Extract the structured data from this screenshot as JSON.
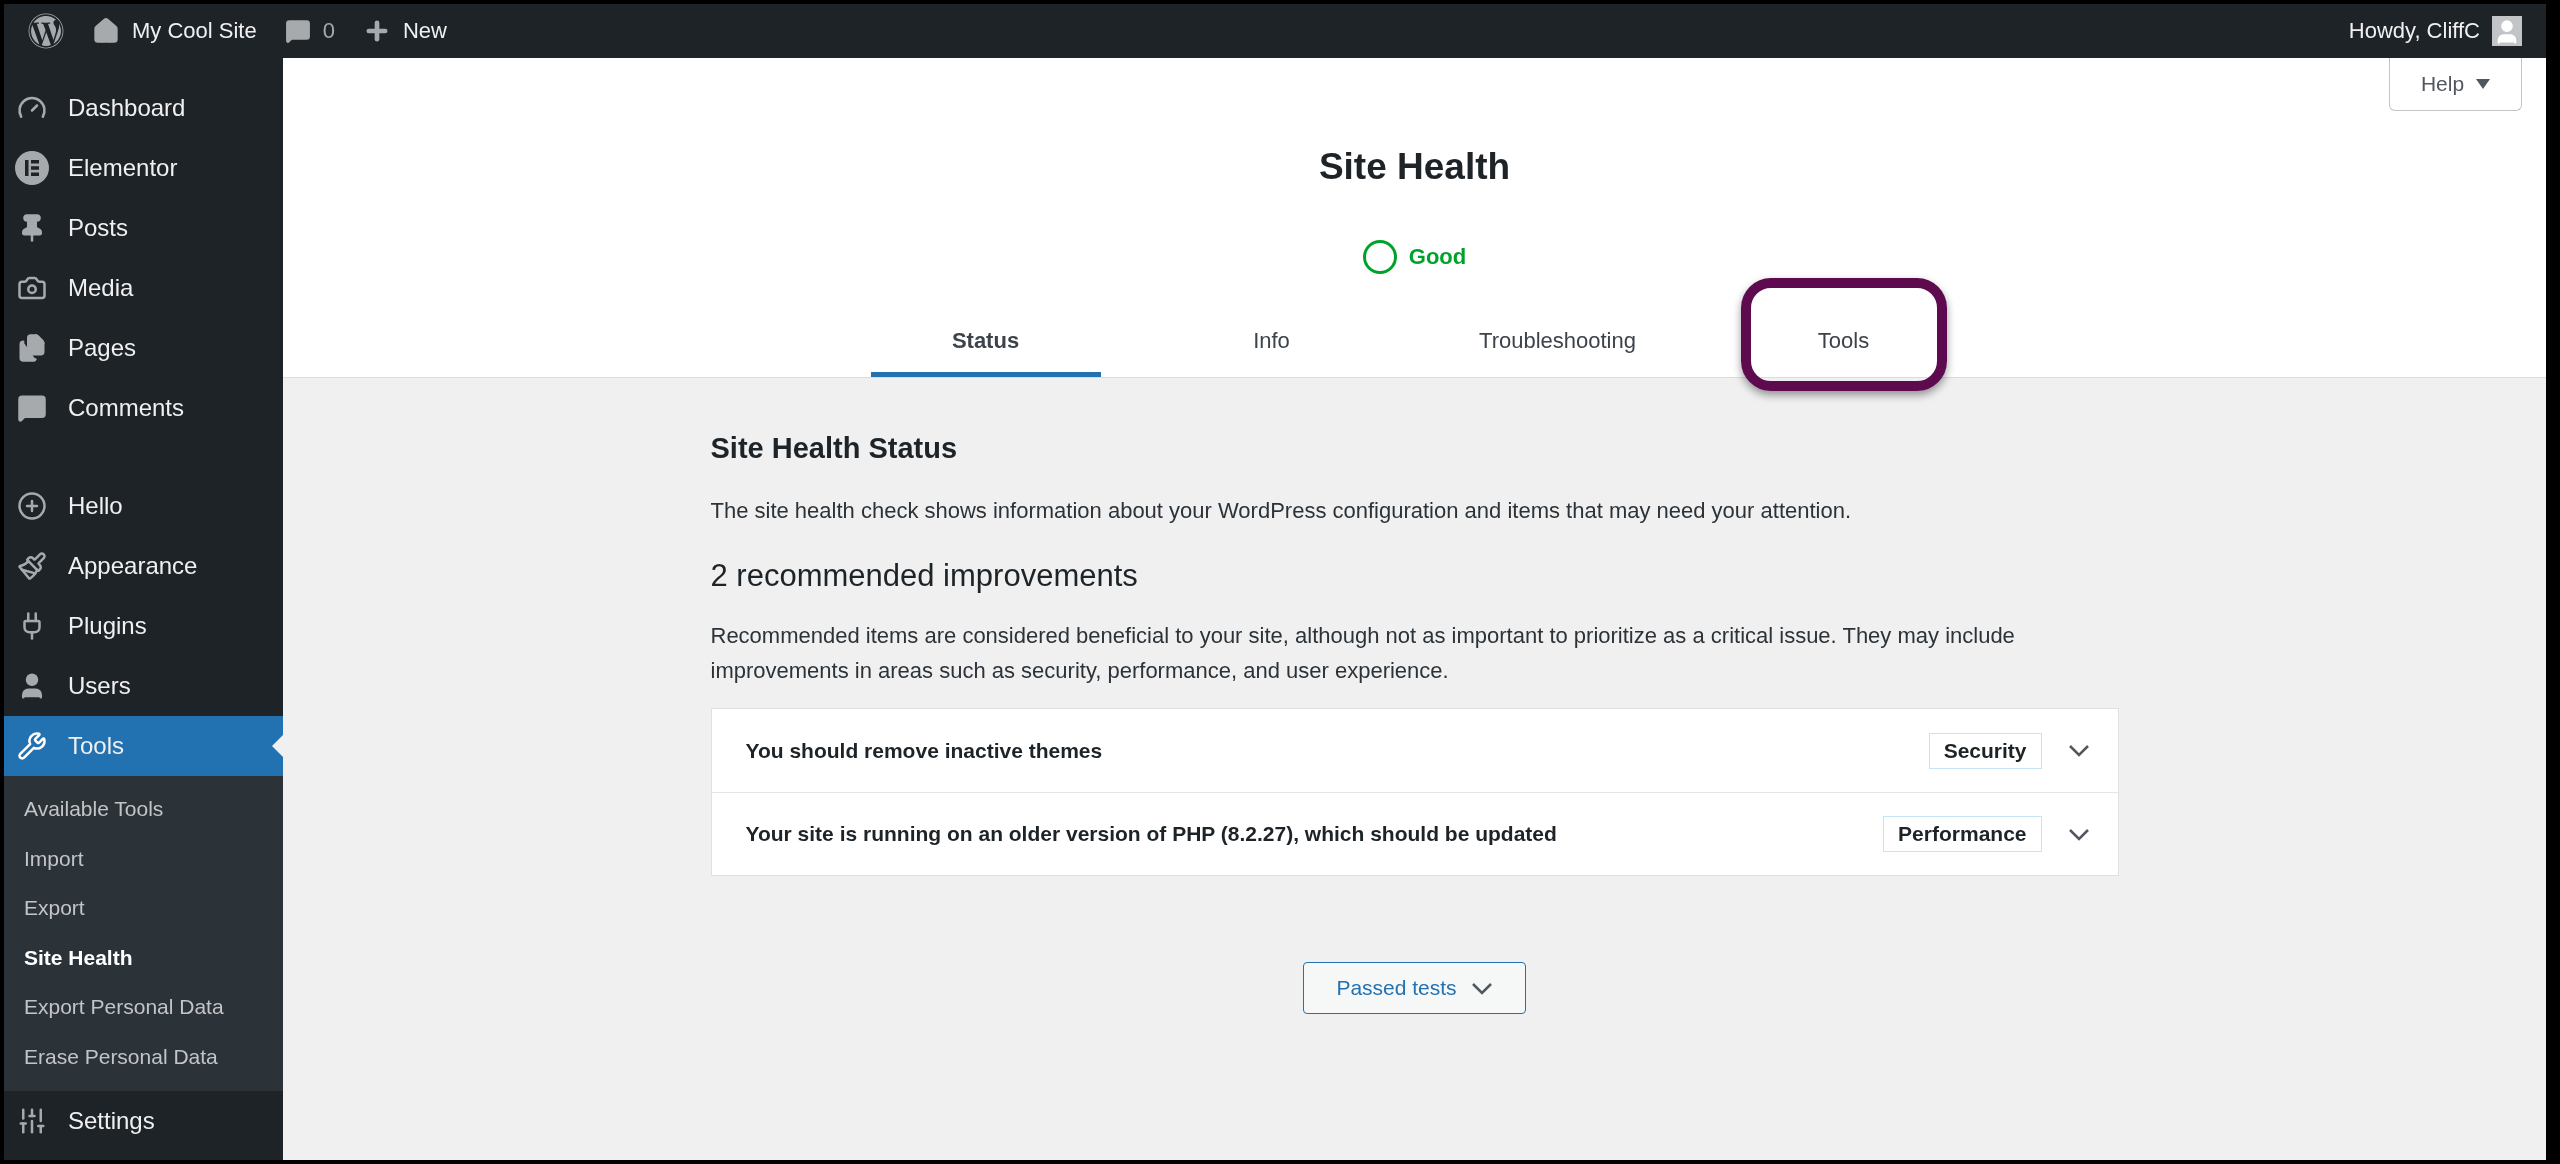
{
  "admin_bar": {
    "site_name": "My Cool Site",
    "comments_count": "0",
    "new_label": "New",
    "greeting": "Howdy, CliffC"
  },
  "sidebar": {
    "groups": [
      {
        "items": [
          {
            "label": "Dashboard",
            "selected": false
          },
          {
            "label": "Elementor",
            "selected": false
          },
          {
            "label": "Posts",
            "selected": false
          },
          {
            "label": "Media",
            "selected": false
          },
          {
            "label": "Pages",
            "selected": false
          },
          {
            "label": "Comments",
            "selected": false
          }
        ]
      },
      {
        "items": [
          {
            "label": "Hello",
            "selected": false
          },
          {
            "label": "Appearance",
            "selected": false
          },
          {
            "label": "Plugins",
            "selected": false
          },
          {
            "label": "Users",
            "selected": false
          },
          {
            "label": "Tools",
            "selected": true,
            "children": [
              {
                "label": "Available Tools",
                "selected": false
              },
              {
                "label": "Import",
                "selected": false
              },
              {
                "label": "Export",
                "selected": false
              },
              {
                "label": "Site Health",
                "selected": true
              },
              {
                "label": "Export Personal Data",
                "selected": false
              },
              {
                "label": "Erase Personal Data",
                "selected": false
              }
            ]
          },
          {
            "label": "Settings",
            "selected": false
          }
        ]
      }
    ]
  },
  "help_button": "Help",
  "page_title": "Site Health",
  "status": {
    "label": "Good"
  },
  "tabs": [
    {
      "label": "Status",
      "selected": true,
      "highlighted": false
    },
    {
      "label": "Info",
      "selected": false,
      "highlighted": false
    },
    {
      "label": "Troubleshooting",
      "selected": false,
      "highlighted": false
    },
    {
      "label": "Tools",
      "selected": false,
      "highlighted": true
    }
  ],
  "section_title": "Site Health Status",
  "section_text": "The site health check shows information about your WordPress configuration and items that may need your attention.",
  "improvements_title": "2 recommended improvements",
  "improvements_text": "Recommended items are considered beneficial to your site, although not as important to prioritize as a critical issue. They may include improvements in areas such as security, performance, and user experience.",
  "issues": [
    {
      "title": "You should remove inactive themes",
      "badge": "Security"
    },
    {
      "title": "Your site is running on an older version of PHP (8.2.27), which should be updated",
      "badge": "Performance"
    }
  ],
  "passed_tests_button": "Passed tests"
}
